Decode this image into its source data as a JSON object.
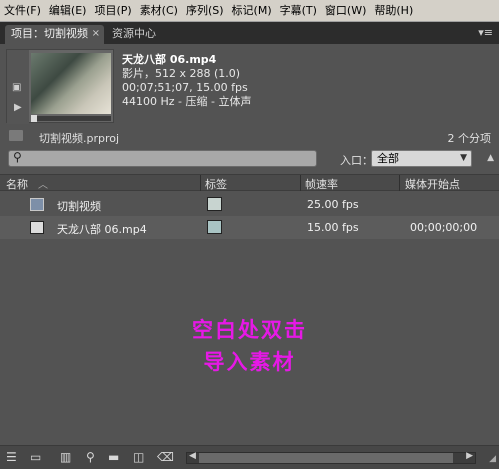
{
  "menu": {
    "file": "文件(F)",
    "edit": "编辑(E)",
    "project": "项目(P)",
    "clip": "素材(C)",
    "sequence": "序列(S)",
    "marker": "标记(M)",
    "title": "字幕(T)",
    "window": "窗口(W)",
    "help": "帮助(H)"
  },
  "tabs": {
    "project_tab": "项目：切割视频",
    "close_glyph": "×",
    "resource_tab": "资源中心",
    "menu_glyph": "▾≡"
  },
  "preview": {
    "filename": "天龙八部 06.mp4",
    "line1": "影片，512 x 288 (1.0)",
    "line2": "00;07;51;07, 15.00 fps",
    "line3": "44100 Hz - 压缩 - 立体声"
  },
  "project": {
    "file": "切割视频.prproj",
    "count": "2 个分项"
  },
  "search": {
    "glyph": "⚲",
    "in_label": "入口：",
    "in_value": "全部"
  },
  "columns": {
    "name": "名称",
    "sort_glyph": "︿",
    "label": "标签",
    "frame_rate": "帧速率",
    "media_start": "媒体开始点"
  },
  "items": [
    {
      "name": "切割视频",
      "label_color": "#c8d4d0",
      "frame_rate": "25.00 fps",
      "media_start": ""
    },
    {
      "name": "天龙八部 06.mp4",
      "label_color": "#a9c4c4",
      "frame_rate": "15.00 fps",
      "media_start": "00;00;00;00"
    }
  ],
  "hint": {
    "line1": "空白处双击",
    "line2": "导入素材"
  },
  "colors": {
    "hint": "#e619e6",
    "panel_bg": "#535353"
  },
  "icons": {
    "list_view": "list-view-icon",
    "icon_view": "icon-view-icon",
    "automate": "automate-to-sequence-icon",
    "find": "find-icon",
    "new_bin": "new-bin-icon",
    "new_item": "new-item-icon",
    "clear": "clear-icon"
  }
}
